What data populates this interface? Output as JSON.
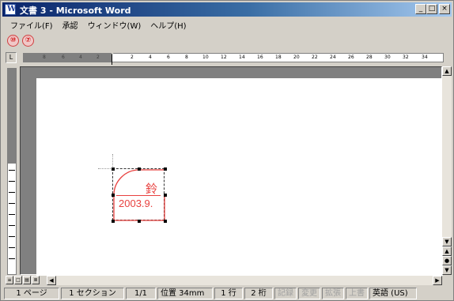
{
  "window": {
    "title": "文書 3 - Microsoft Word",
    "minimize_label": "_",
    "maximize_label": "□",
    "close_label": "×"
  },
  "menubar": {
    "items": [
      "ファイル(F)",
      "承認",
      "ウィンドウ(W)",
      "ヘルプ(H)"
    ]
  },
  "toolbar": {
    "buttons": [
      {
        "icon": "stamp-number-icon",
        "glyph": "⑩"
      },
      {
        "icon": "stamp-approve-icon",
        "glyph": "⑦"
      }
    ]
  },
  "ruler": {
    "corner": "L",
    "ticks": [
      "8",
      "6",
      "4",
      "2",
      "",
      "2",
      "4",
      "6",
      "8",
      "10",
      "12",
      "14",
      "16",
      "18",
      "20",
      "22",
      "24",
      "26",
      "28",
      "30",
      "32",
      "34"
    ]
  },
  "stamp": {
    "name": "鈴",
    "date": "2003.9.",
    "color": "#e8413f"
  },
  "statusbar": {
    "page": "1 ページ",
    "section": "1 セクション",
    "pages": "1/1",
    "position": "位置 34mm",
    "line": "1 行",
    "column": "2 桁",
    "rec": "記録",
    "trk": "変更",
    "ext": "拡張",
    "ovr": "上書",
    "language": "英語 (US)"
  }
}
